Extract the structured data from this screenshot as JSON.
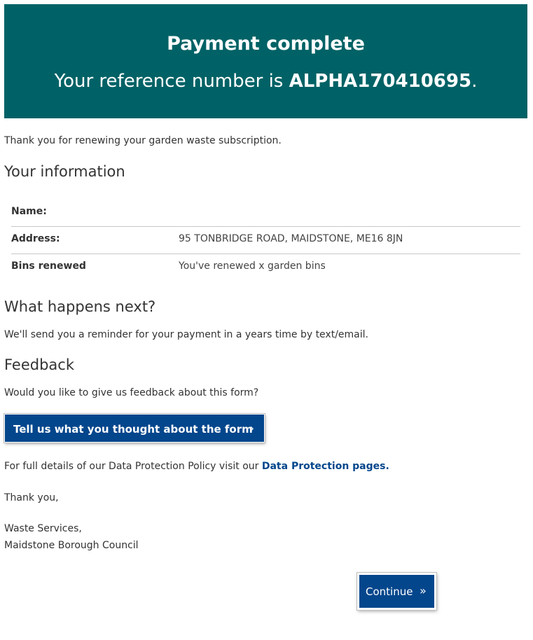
{
  "banner": {
    "title": "Payment complete",
    "ref_prefix": "Your reference number is ",
    "ref_number": "ALPHA170410695",
    "ref_suffix": "."
  },
  "intro": "Thank you for renewing your garden waste subscription.",
  "info": {
    "heading": "Your information",
    "rows": [
      {
        "label": "Name:",
        "value": ""
      },
      {
        "label": "Address:",
        "value": "95 TONBRIDGE ROAD, MAIDSTONE, ME16 8JN"
      },
      {
        "label": "Bins renewed",
        "value": "You've renewed x garden bins"
      }
    ]
  },
  "next": {
    "heading": "What happens next?",
    "text": "We'll send you a reminder for your payment in a years time by text/email."
  },
  "feedback": {
    "heading": "Feedback",
    "question": "Would you like to give us feedback about this form?",
    "button_label": "Tell us what you thought about the form",
    "button_icon": "chevron-right-icon"
  },
  "data_protection": {
    "text": "For full details of our Data Protection Policy visit our ",
    "link": "Data Protection pages."
  },
  "signoff": {
    "thanks": "Thank you,",
    "line1": "Waste Services,",
    "line2": "Maidstone Borough Council"
  },
  "continue": {
    "label": "Continue",
    "icon": "double-chevron-right-icon"
  },
  "colors": {
    "banner": "#006266",
    "button": "#03468c",
    "link": "#03468c"
  }
}
